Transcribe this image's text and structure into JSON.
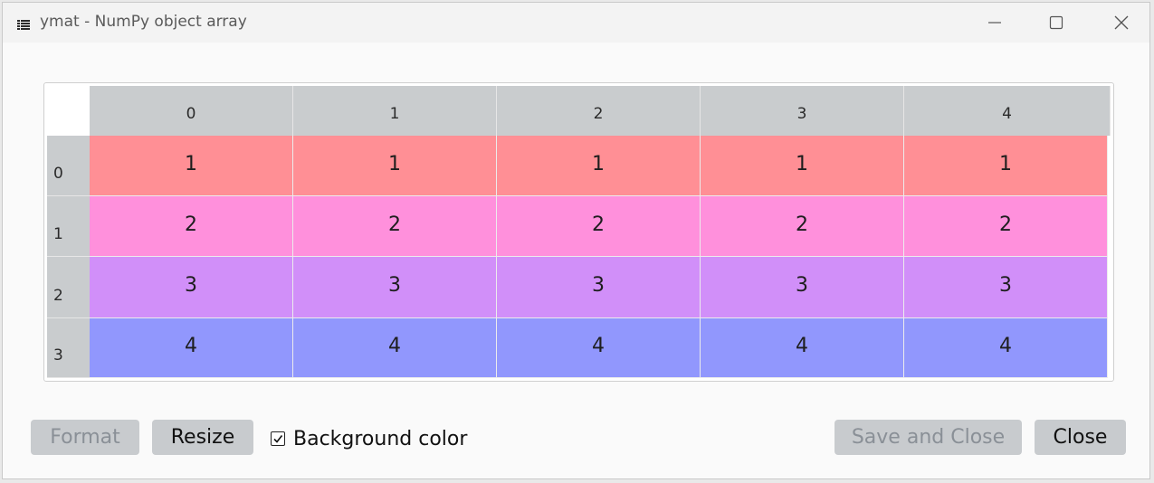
{
  "window": {
    "title": "ymat - NumPy object array"
  },
  "table": {
    "columns": [
      "0",
      "1",
      "2",
      "3",
      "4"
    ],
    "rows": [
      {
        "label": "0",
        "color": "#ff8f95",
        "cells": [
          "1",
          "1",
          "1",
          "1",
          "1"
        ]
      },
      {
        "label": "1",
        "color": "#ff90dc",
        "cells": [
          "2",
          "2",
          "2",
          "2",
          "2"
        ]
      },
      {
        "label": "2",
        "color": "#d18ff9",
        "cells": [
          "3",
          "3",
          "3",
          "3",
          "3"
        ]
      },
      {
        "label": "3",
        "color": "#9197fd",
        "cells": [
          "4",
          "4",
          "4",
          "4",
          "4"
        ]
      }
    ]
  },
  "footer": {
    "format_label": "Format",
    "resize_label": "Resize",
    "background_color_label": "Background color",
    "background_color_checked": true,
    "save_close_label": "Save and Close",
    "close_label": "Close"
  },
  "icons": {
    "app": "table-icon",
    "minimize": "minimize-icon",
    "maximize": "maximize-icon",
    "close": "close-icon",
    "check": "check-icon"
  }
}
